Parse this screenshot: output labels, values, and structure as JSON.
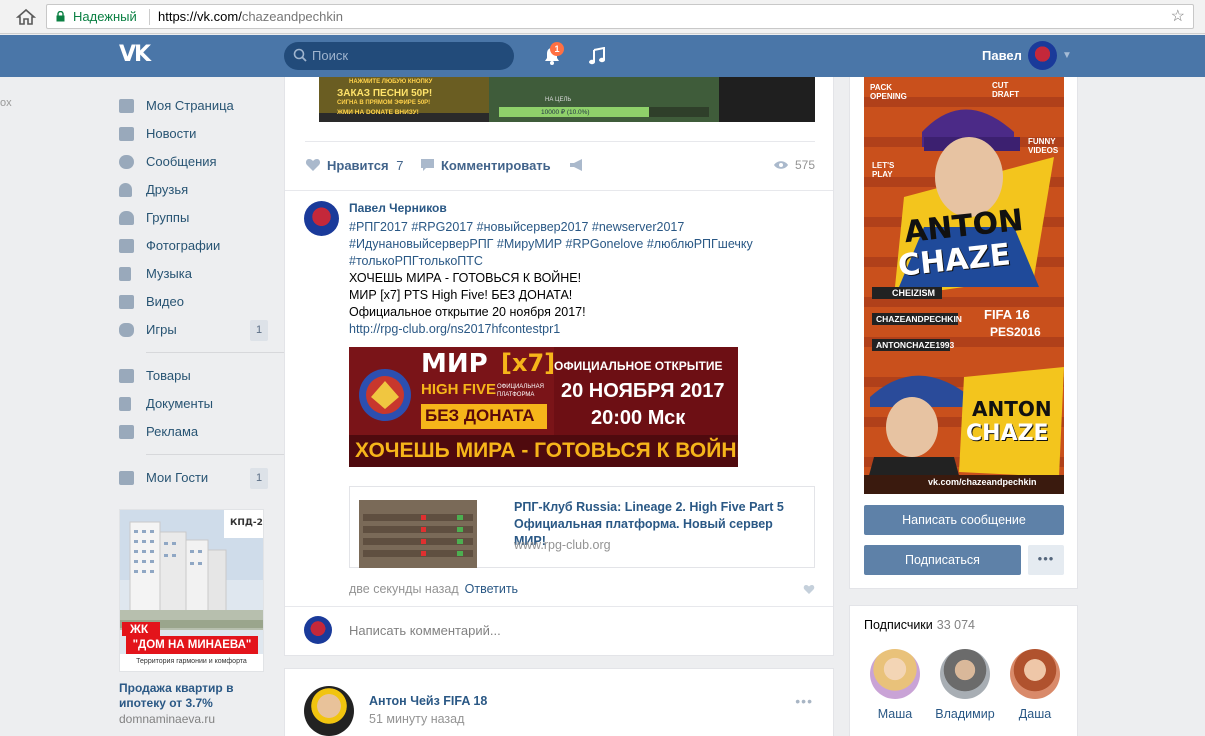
{
  "browser": {
    "secure_label": "Надежный",
    "url_host": "https://vk.com/",
    "url_path": "chazeandpechkin"
  },
  "header": {
    "search_placeholder": "Поиск",
    "notification_count": "1",
    "user_name": "Павел"
  },
  "left_edge_text": "ox",
  "menu": {
    "items": [
      {
        "label": "Моя Страница",
        "icon": "home-icon"
      },
      {
        "label": "Новости",
        "icon": "news-icon"
      },
      {
        "label": "Сообщения",
        "icon": "messages-icon"
      },
      {
        "label": "Друзья",
        "icon": "friends-icon"
      },
      {
        "label": "Группы",
        "icon": "groups-icon"
      },
      {
        "label": "Фотографии",
        "icon": "camera-icon"
      },
      {
        "label": "Музыка",
        "icon": "music-icon"
      },
      {
        "label": "Видео",
        "icon": "video-icon"
      },
      {
        "label": "Игры",
        "icon": "gamepad-icon",
        "count": "1"
      }
    ],
    "items2": [
      {
        "label": "Товары",
        "icon": "bag-icon"
      },
      {
        "label": "Документы",
        "icon": "document-icon"
      },
      {
        "label": "Реклама",
        "icon": "megaphone-icon"
      }
    ],
    "items3": [
      {
        "label": "Мои Гости",
        "icon": "grid-icon",
        "count": "1"
      }
    ]
  },
  "ad": {
    "badge": "ЖК",
    "banner_title": "\"ДОМ НА МИНАЕВА\"",
    "banner_sub": "Территория гармонии и комфорта",
    "logo_text": "КПД-2",
    "title": "Продажа квартир в ипотеку от 3.7%",
    "domain": "domnaminaeva.ru"
  },
  "top_banner": {
    "line1": "НАЖМИТЕ ЛЮБУЮ КНОПКУ",
    "line2": "ЗАКАЗ ПЕСНИ 50Р!",
    "line3": "СИГНА В ПРЯМОМ ЭФИРЕ 50Р!",
    "line4": "ЖМИ НА DONATE ВНИЗУ!",
    "goal": "10000 ₽ (10.0%)",
    "goal_label": "НА ЦЕЛЬ"
  },
  "actions": {
    "like_label": "Нравится",
    "like_count": "7",
    "comment_label": "Комментировать",
    "views": "575"
  },
  "post": {
    "author": "Павел Черников",
    "tags1": "#РПГ2017 #RPG2017 #новыйсервер2017 #newserver2017",
    "tags2": "#ИдунановыйсерверРПГ #МируМИР #RPGonelove #люблюРПГшечку",
    "tags3": "#толькоРПГтолькоПТС",
    "line1": "ХОЧЕШЬ МИРА - ГОТОВЬСЯ К ВОЙНЕ!",
    "line2": "МИР [x7] PTS High Five! БЕЗ ДОНАТА!",
    "line3": "Официальное открытие 20 ноября 2017!",
    "link": "http://rpg-club.org/ns2017hfcontestpr1",
    "image": {
      "mir": "МИР",
      "x7": "[x7]",
      "hf": "HIGH FIVE",
      "platform": "ОФИЦИАЛЬНАЯ ПЛАТФОРМА",
      "nodonate": "БЕЗ ДОНАТА",
      "opening": "ОФИЦИАЛЬНОЕ ОТКРЫТИЕ",
      "date": "20 НОЯБРЯ 2017",
      "time": "20:00 Мск",
      "slogan": "ХОЧЕШЬ МИРА - ГОТОВЬСЯ К ВОЙНЕ"
    },
    "snippet_title": "РПГ-Клуб Russia: Lineage 2. High Five Part 5 Официальная платформа. Новый сервер МИР!",
    "snippet_domain": "www.rpg-club.org",
    "time": "две секунды назад",
    "reply": "Ответить",
    "comment_placeholder": "Написать комментарий..."
  },
  "post2": {
    "author": "Антон Чейз FIFA 18",
    "time": "51 минуту назад"
  },
  "right": {
    "cover": {
      "name1": "ANTON",
      "name2": "CHAZE",
      "youtube": "CHEIZISM",
      "vk": "CHAZEANDPECHKIN",
      "twitch": "ANTONCHAZE1993",
      "fifa": "FIFA 16",
      "pes": "PES2016",
      "site": "vk.com/chazeandpechkin",
      "pack": "PACK OPENING",
      "draft": "CUT DRAFT",
      "lets": "LET'S PLAY",
      "funny": "FUNNY VIDEOS"
    },
    "btn_message": "Написать сообщение",
    "btn_subscribe": "Подписаться",
    "subscribers_label": "Подписчики",
    "subscribers_count": "33 074",
    "subscribers": [
      {
        "name": "Маша"
      },
      {
        "name": "Владимир"
      },
      {
        "name": "Даша"
      }
    ]
  }
}
